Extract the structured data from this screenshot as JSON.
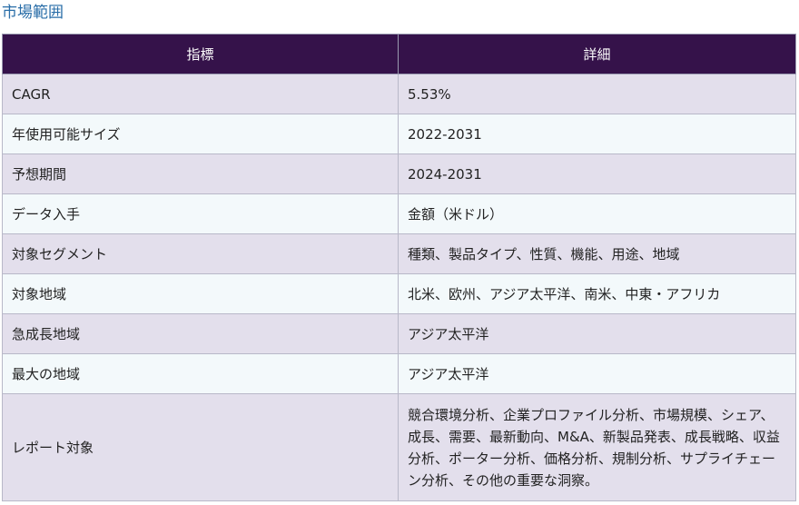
{
  "section_title": "市場範囲",
  "table": {
    "headers": [
      "指標",
      "詳細"
    ],
    "rows": [
      {
        "label": "CAGR",
        "value": "5.53%"
      },
      {
        "label": "年使用可能サイズ",
        "value": "2022-2031"
      },
      {
        "label": "予想期間",
        "value": "2024-2031"
      },
      {
        "label": "データ入手",
        "value": "金額（米ドル）"
      },
      {
        "label": "対象セグメント",
        "value": "種類、製品タイプ、性質、機能、用途、地域"
      },
      {
        "label": "対象地域",
        "value": "北米、欧州、アジア太平洋、南米、中東・アフリカ"
      },
      {
        "label": "急成長地域",
        "value": "アジア太平洋"
      },
      {
        "label": "最大の地域",
        "value": "アジア太平洋"
      },
      {
        "label": "レポート対象",
        "value": "競合環境分析、企業プロファイル分析、市場規模、シェア、成長、需要、最新動向、M&A、新製品発表、成長戦略、収益分析、ポーター分析、価格分析、規制分析、サプライチェーン分析、その他の重要な洞察。"
      }
    ]
  }
}
